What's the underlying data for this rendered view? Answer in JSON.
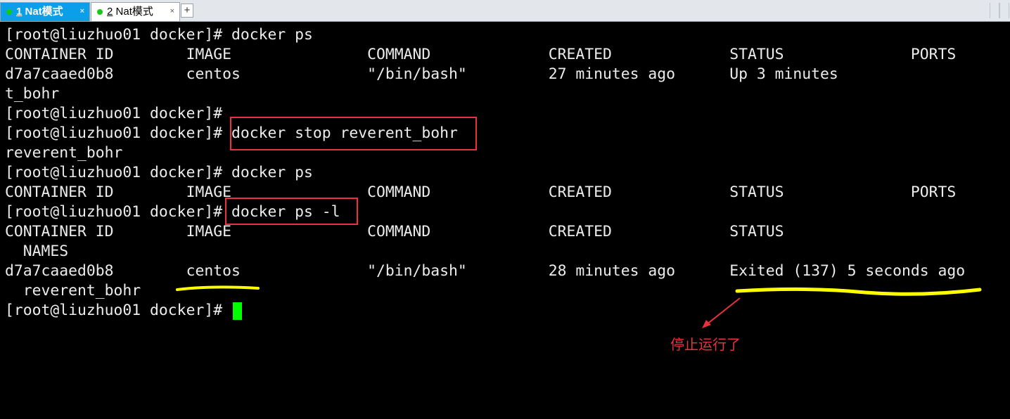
{
  "tabs": [
    {
      "number": "1",
      "label": "Nat模式",
      "close": "×"
    },
    {
      "number": "2",
      "label": "Nat模式",
      "close": "×"
    }
  ],
  "new_tab_label": "+",
  "terminal": {
    "lines": [
      "[root@liuzhuo01 docker]# docker ps",
      "CONTAINER ID        IMAGE               COMMAND             CREATED             STATUS              PORTS",
      "d7a7caaed0b8        centos              \"/bin/bash\"         27 minutes ago      Up 3 minutes",
      "t_bohr",
      "[root@liuzhuo01 docker]#",
      "[root@liuzhuo01 docker]# docker stop reverent_bohr",
      "reverent_bohr",
      "[root@liuzhuo01 docker]# docker ps",
      "CONTAINER ID        IMAGE               COMMAND             CREATED             STATUS              PORTS",
      "[root@liuzhuo01 docker]# docker ps -l",
      "CONTAINER ID        IMAGE               COMMAND             CREATED             STATUS                          P",
      "  NAMES",
      "d7a7caaed0b8        centos              \"/bin/bash\"         28 minutes ago      Exited (137) 5 seconds ago",
      "  reverent_bohr",
      "[root@liuzhuo01 docker]# "
    ]
  },
  "annotation": {
    "note": "停止运行了",
    "box_color": "#e8323c",
    "highlight_color": "#ffff00"
  },
  "colors": {
    "tab_active_bg": "#0a9fe8",
    "status_dot": "#17c917",
    "cursor": "#00ff00",
    "terminal_bg": "#000000",
    "terminal_fg": "#ececec"
  }
}
